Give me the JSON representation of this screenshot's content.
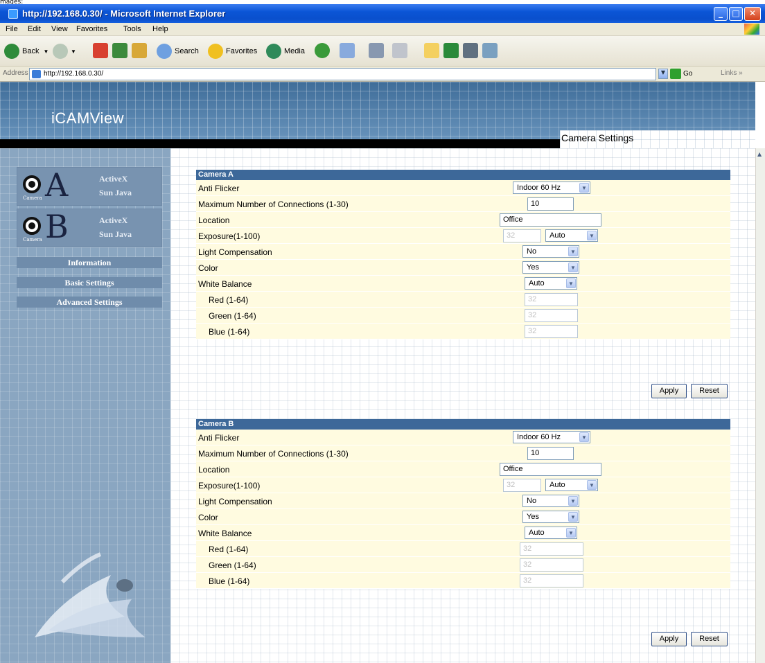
{
  "window": {
    "top_caption": "mages:",
    "title": "http://192.168.0.30/ - Microsoft Internet Explorer"
  },
  "menu": [
    "File",
    "Edit",
    "View",
    "Favorites",
    "Tools",
    "Help"
  ],
  "toolbar": {
    "back": "Back",
    "search": "Search",
    "favorites": "Favorites",
    "media": "Media"
  },
  "address": {
    "label": "Address",
    "url": "http://192.168.0.30/",
    "go": "Go",
    "links": "Links"
  },
  "page": {
    "logo": "iCAMView",
    "title": "Camera Settings"
  },
  "sidebar": {
    "cam_a": {
      "letter": "A",
      "caption": "Camera",
      "activex": "ActiveX",
      "java": "Sun Java"
    },
    "cam_b": {
      "letter": "B",
      "caption": "Camera",
      "activex": "ActiveX",
      "java": "Sun Java"
    },
    "nav": [
      "Information",
      "Basic Settings",
      "Advanced Settings"
    ]
  },
  "camera_a": {
    "header": "Camera A",
    "anti_flicker": {
      "label": "Anti Flicker",
      "value": "Indoor 60 Hz"
    },
    "max_conn": {
      "label": "Maximum Number of Connections (1-30)",
      "value": "10"
    },
    "location": {
      "label": "Location",
      "value": "Office"
    },
    "exposure": {
      "label": "Exposure(1-100)",
      "value": "32",
      "mode": "Auto"
    },
    "light_comp": {
      "label": "Light Compensation",
      "value": "No"
    },
    "color": {
      "label": "Color",
      "value": "Yes"
    },
    "white_balance": {
      "label": "White Balance",
      "value": "Auto"
    },
    "red": {
      "label": "Red (1-64)",
      "value": "32"
    },
    "green": {
      "label": "Green (1-64)",
      "value": "32"
    },
    "blue": {
      "label": "Blue (1-64)",
      "value": "32"
    },
    "apply": "Apply",
    "reset": "Reset"
  },
  "camera_b": {
    "header": "Camera B",
    "anti_flicker": {
      "label": "Anti Flicker",
      "value": "Indoor 60 Hz"
    },
    "max_conn": {
      "label": "Maximum Number of Connections (1-30)",
      "value": "10"
    },
    "location": {
      "label": "Location",
      "value": "Office"
    },
    "exposure": {
      "label": "Exposure(1-100)",
      "value": "32",
      "mode": "Auto"
    },
    "light_comp": {
      "label": "Light Compensation",
      "value": "No"
    },
    "color": {
      "label": "Color",
      "value": "Yes"
    },
    "white_balance": {
      "label": "White Balance",
      "value": "Auto"
    },
    "red": {
      "label": "Red (1-64)",
      "value": "32"
    },
    "green": {
      "label": "Green (1-64)",
      "value": "32"
    },
    "blue": {
      "label": "Blue (1-64)",
      "value": "32"
    },
    "apply": "Apply",
    "reset": "Reset"
  },
  "colors": {
    "title_bar": "#0b55d6",
    "panel_header": "#3d6899",
    "row_bg": "#fffbe0",
    "sidebar": "#8aa6c1"
  }
}
